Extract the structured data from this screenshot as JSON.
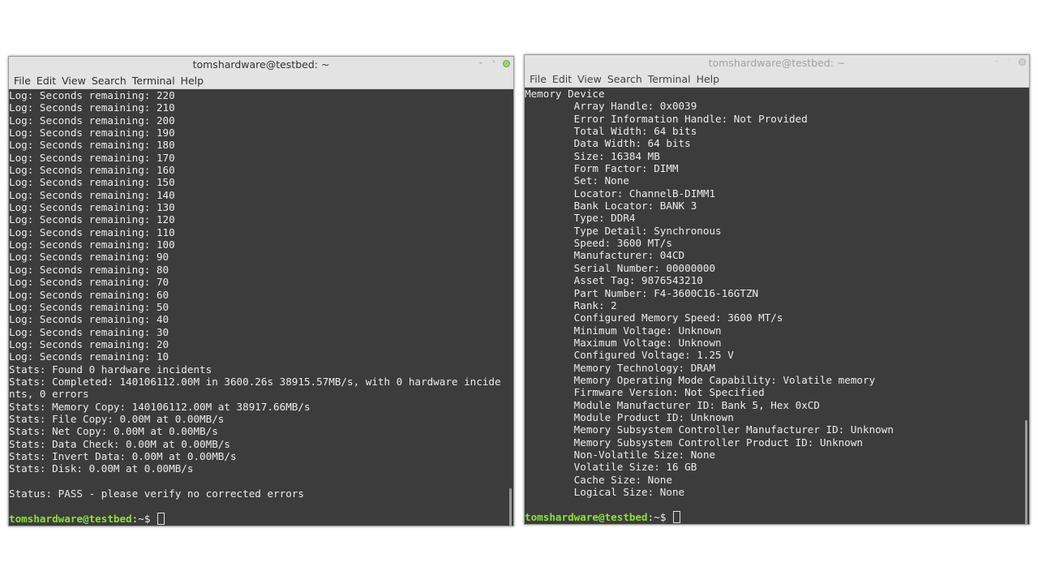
{
  "left_window": {
    "title": "tomshardware@testbed: ~",
    "menu": [
      "File",
      "Edit",
      "View",
      "Search",
      "Terminal",
      "Help"
    ],
    "lines": [
      "Log: Seconds remaining: 220",
      "Log: Seconds remaining: 210",
      "Log: Seconds remaining: 200",
      "Log: Seconds remaining: 190",
      "Log: Seconds remaining: 180",
      "Log: Seconds remaining: 170",
      "Log: Seconds remaining: 160",
      "Log: Seconds remaining: 150",
      "Log: Seconds remaining: 140",
      "Log: Seconds remaining: 130",
      "Log: Seconds remaining: 120",
      "Log: Seconds remaining: 110",
      "Log: Seconds remaining: 100",
      "Log: Seconds remaining: 90",
      "Log: Seconds remaining: 80",
      "Log: Seconds remaining: 70",
      "Log: Seconds remaining: 60",
      "Log: Seconds remaining: 50",
      "Log: Seconds remaining: 40",
      "Log: Seconds remaining: 30",
      "Log: Seconds remaining: 20",
      "Log: Seconds remaining: 10",
      "Stats: Found 0 hardware incidents",
      "Stats: Completed: 140106112.00M in 3600.26s 38915.57MB/s, with 0 hardware incide",
      "nts, 0 errors",
      "Stats: Memory Copy: 140106112.00M at 38917.66MB/s",
      "Stats: File Copy: 0.00M at 0.00MB/s",
      "Stats: Net Copy: 0.00M at 0.00MB/s",
      "Stats: Data Check: 0.00M at 0.00MB/s",
      "Stats: Invert Data: 0.00M at 0.00MB/s",
      "Stats: Disk: 0.00M at 0.00MB/s",
      "",
      "Status: PASS - please verify no corrected errors",
      ""
    ],
    "prompt_user": "tomshardware@testbed",
    "prompt_rest": ":~$ "
  },
  "right_window": {
    "title": "tomshardware@testbed: ~",
    "menu": [
      "File",
      "Edit",
      "View",
      "Search",
      "Terminal",
      "Help"
    ],
    "lines": [
      "Memory Device",
      "        Array Handle: 0x0039",
      "        Error Information Handle: Not Provided",
      "        Total Width: 64 bits",
      "        Data Width: 64 bits",
      "        Size: 16384 MB",
      "        Form Factor: DIMM",
      "        Set: None",
      "        Locator: ChannelB-DIMM1",
      "        Bank Locator: BANK 3",
      "        Type: DDR4",
      "        Type Detail: Synchronous",
      "        Speed: 3600 MT/s",
      "        Manufacturer: 04CD",
      "        Serial Number: 00000000",
      "        Asset Tag: 9876543210",
      "        Part Number: F4-3600C16-16GTZN",
      "        Rank: 2",
      "        Configured Memory Speed: 3600 MT/s",
      "        Minimum Voltage: Unknown",
      "        Maximum Voltage: Unknown",
      "        Configured Voltage: 1.25 V",
      "        Memory Technology: DRAM",
      "        Memory Operating Mode Capability: Volatile memory",
      "        Firmware Version: Not Specified",
      "        Module Manufacturer ID: Bank 5, Hex 0xCD",
      "        Module Product ID: Unknown",
      "        Memory Subsystem Controller Manufacturer ID: Unknown",
      "        Memory Subsystem Controller Product ID: Unknown",
      "        Non-Volatile Size: None",
      "        Volatile Size: 16 GB",
      "        Cache Size: None",
      "        Logical Size: None",
      ""
    ],
    "prompt_user": "tomshardware@testbed",
    "prompt_rest": ":~$ "
  }
}
